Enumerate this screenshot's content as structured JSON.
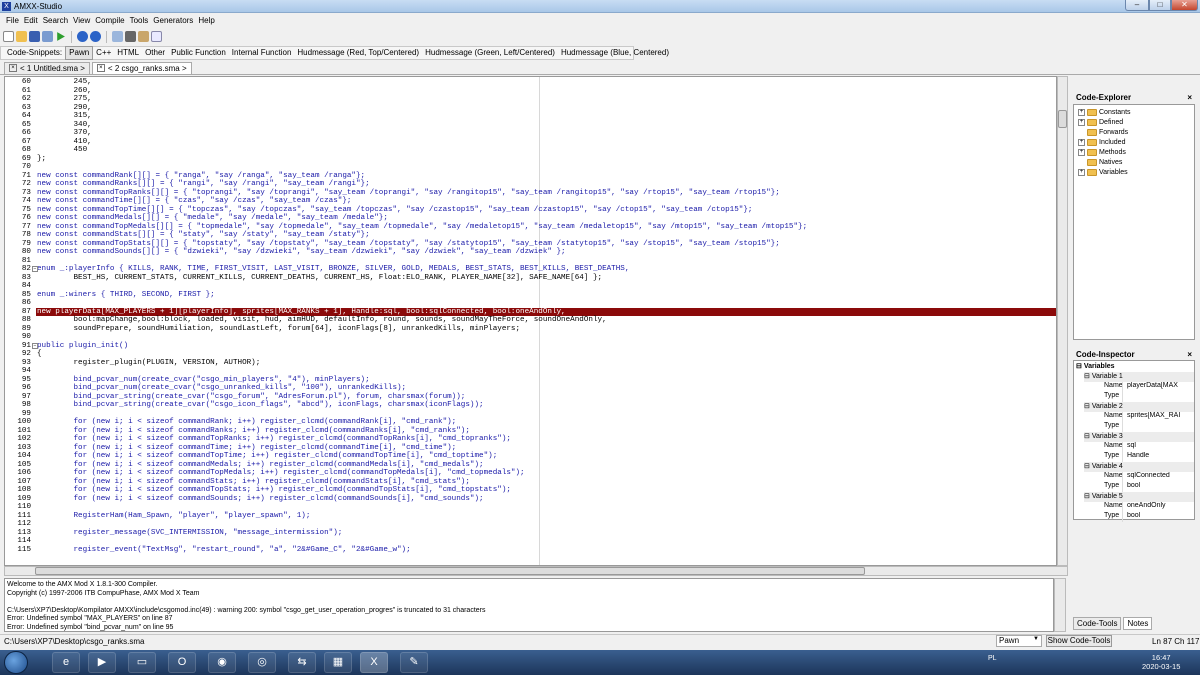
{
  "window": {
    "title": "AMXX-Studio",
    "min": "–",
    "max": "□",
    "close": "✕"
  },
  "menu": [
    "File",
    "Edit",
    "Search",
    "View",
    "Compile",
    "Tools",
    "Generators",
    "Help"
  ],
  "snippets": [
    "Code-Snippets:",
    "Pawn",
    "C++",
    "HTML",
    "Other",
    "Public Function",
    "Internal Function",
    "Hudmessage (Red, Top/Centered)",
    "Hudmessage (Green, Left/Centered)",
    "Hudmessage (Blue, Centered)"
  ],
  "tabs": [
    {
      "label": "< 1 Untitled.sma >"
    },
    {
      "label": "< 2 csgo_ranks.sma >"
    }
  ],
  "editor": {
    "line_numbers": [
      "60",
      "61",
      "62",
      "63",
      "64",
      "65",
      "66",
      "67",
      "68",
      "69",
      "70",
      "71",
      "72",
      "73",
      "74",
      "75",
      "76",
      "77",
      "78",
      "79",
      "80",
      "81",
      "82",
      "83",
      "84",
      "85",
      "86",
      "87",
      "88",
      "89",
      "90",
      "91",
      "92",
      "93",
      "94",
      "95",
      "96",
      "97",
      "98",
      "99",
      "100",
      "101",
      "102",
      "103",
      "104",
      "105",
      "106",
      "107",
      "108",
      "109",
      "110",
      "111",
      "112",
      "113",
      "114",
      "115"
    ],
    "lines": [
      "        245,",
      "        260,",
      "        275,",
      "        290,",
      "        315,",
      "        340,",
      "        370,",
      "        410,",
      "        450",
      "};",
      "",
      "new const commandRank[][] = { \"ranga\", \"say /ranga\", \"say_team /ranga\"};",
      "new const commandRanks[][] = { \"rangi\", \"say /rangi\", \"say_team /rangi\"};",
      "new const commandTopRanks[][] = { \"toprangi\", \"say /toprangi\", \"say_team /toprangi\", \"say /rangitop15\", \"say_team /rangitop15\", \"say /rtop15\", \"say_team /rtop15\"};",
      "new const commandTime[][] = { \"czas\", \"say /czas\", \"say_team /czas\"};",
      "new const commandTopTime[][] = { \"topczas\", \"say /topczas\", \"say_team /topczas\", \"say /czastop15\", \"say_team /czastop15\", \"say /ctop15\", \"say_team /ctop15\"};",
      "new const commandMedals[][] = { \"medale\", \"say /medale\", \"say_team /medale\"};",
      "new const commandTopMedals[][] = { \"topmedale\", \"say /topmedale\", \"say_team /topmedale\", \"say /medaletop15\", \"say_team /medaletop15\", \"say /mtop15\", \"say_team /mtop15\"};",
      "new const commandStats[][] = { \"staty\", \"say /staty\", \"say_team /staty\"};",
      "new const commandTopStats[][] = { \"topstaty\", \"say /topstaty\", \"say_team /topstaty\", \"say /statytop15\", \"say_team /statytop15\", \"say /stop15\", \"say_team /stop15\"};",
      "new const commandSounds[][] = { \"dzwieki\", \"say /dzwieki\", \"say_team /dzwieki\", \"say /dzwiek\", \"say_team /dzwiek\" };",
      "",
      "enum _:playerInfo { KILLS, RANK, TIME, FIRST_VISIT, LAST_VISIT, BRONZE, SILVER, GOLD, MEDALS, BEST_STATS, BEST_KILLS, BEST_DEATHS,",
      "        BEST_HS, CURRENT_STATS, CURRENT_KILLS, CURRENT_DEATHS, CURRENT_HS, Float:ELO_RANK, PLAYER_NAME[32], SAFE_NAME[64] };",
      "",
      "enum _:winers { THIRD, SECOND, FIRST };",
      "",
      "new playerData[MAX_PLAYERS + 1][playerInfo], sprites[MAX_RANKS + 1], Handle:sql, bool:sqlConnected, bool:oneAndOnly,",
      "        bool:mapChange,bool:block, loaded, visit, hud, aimHUD, defaultInfo, round, sounds, soundMayTheForce, soundOneAndOnly,",
      "        soundPrepare, soundHumiliation, soundLastLeft, forum[64], iconFlags[8], unrankedKills, minPlayers;",
      "",
      "public plugin_init()",
      "{",
      "        register_plugin(PLUGIN, VERSION, AUTHOR);",
      "",
      "        bind_pcvar_num(create_cvar(\"csgo_min_players\", \"4\"), minPlayers);",
      "        bind_pcvar_num(create_cvar(\"csgo_unranked_kills\", \"100\"), unrankedKills);",
      "        bind_pcvar_string(create_cvar(\"csgo_forum\", \"AdresForum.pl\"), forum, charsmax(forum));",
      "        bind_pcvar_string(create_cvar(\"csgo_icon_flags\", \"abcd\"), iconFlags, charsmax(iconFlags));",
      "",
      "        for (new i; i < sizeof commandRank; i++) register_clcmd(commandRank[i], \"cmd_rank\");",
      "        for (new i; i < sizeof commandRanks; i++) register_clcmd(commandRanks[i], \"cmd_ranks\");",
      "        for (new i; i < sizeof commandTopRanks; i++) register_clcmd(commandTopRanks[i], \"cmd_topranks\");",
      "        for (new i; i < sizeof commandTime; i++) register_clcmd(commandTime[i], \"cmd_time\");",
      "        for (new i; i < sizeof commandTopTime; i++) register_clcmd(commandTopTime[i], \"cmd_toptime\");",
      "        for (new i; i < sizeof commandMedals; i++) register_clcmd(commandMedals[i], \"cmd_medals\");",
      "        for (new i; i < sizeof commandTopMedals; i++) register_clcmd(commandTopMedals[i], \"cmd_topmedals\");",
      "        for (new i; i < sizeof commandStats; i++) register_clcmd(commandStats[i], \"cmd_stats\");",
      "        for (new i; i < sizeof commandTopStats; i++) register_clcmd(commandTopStats[i], \"cmd_topstats\");",
      "        for (new i; i < sizeof commandSounds; i++) register_clcmd(commandSounds[i], \"cmd_sounds\");",
      "",
      "        RegisterHam(Ham_Spawn, \"player\", \"player_spawn\", 1);",
      "",
      "        register_message(SVC_INTERMISSION, \"message_intermission\");",
      "",
      "        register_event(\"TextMsg\", \"restart_round\", \"a\", \"2&#Game_C\", \"2&#Game_w\");"
    ],
    "highlight_line_index": 27
  },
  "code_explorer": {
    "title": "Code-Explorer",
    "close": "×",
    "items": [
      "Constants",
      "Defined",
      "Forwards",
      "Included",
      "Methods",
      "Natives",
      "Variables"
    ]
  },
  "code_inspector": {
    "title": "Code-Inspector",
    "close": "×",
    "root": "Variables",
    "variables": [
      {
        "label": "Variable 1",
        "name_key": "Name",
        "name": "playerData[MAX",
        "type_key": "Type",
        "type": ""
      },
      {
        "label": "Variable 2",
        "name_key": "Name",
        "name": "sprites[MAX_RAI",
        "type_key": "Type",
        "type": ""
      },
      {
        "label": "Variable 3",
        "name_key": "Name",
        "name": "sql",
        "type_key": "Type",
        "type": "Handle"
      },
      {
        "label": "Variable 4",
        "name_key": "Name",
        "name": "sqlConnected",
        "type_key": "Type",
        "type": "bool"
      },
      {
        "label": "Variable 5",
        "name_key": "Name",
        "name": "oneAndOnly",
        "type_key": "Type",
        "type": "bool"
      }
    ]
  },
  "bottom_tabs": [
    "Code-Tools",
    "Notes"
  ],
  "output": [
    "Welcome to the AMX Mod X 1.8.1-300 Compiler.",
    "Copyright (c) 1997-2006 ITB CompuPhase, AMX Mod X Team",
    "",
    "C:\\Users\\XP7\\Desktop\\Kompilator AMXX\\include\\csgomod.inc(49) : warning 200: symbol \"csgo_get_user_operation_progres\" is truncated to 31 characters",
    "Error: Undefined symbol \"MAX_PLAYERS\" on line 87",
    "Error: Undefined symbol \"bind_pcvar_num\" on line 95"
  ],
  "status": {
    "path": "C:\\Users\\XP7\\Desktop\\csgo_ranks.sma",
    "language": "Pawn",
    "show_tools": "Show Code-Tools",
    "position": "Ln 87 Ch 117"
  },
  "taskbar": {
    "tray_lang": "PL",
    "time": "16:47",
    "date": "2020-03-15"
  }
}
